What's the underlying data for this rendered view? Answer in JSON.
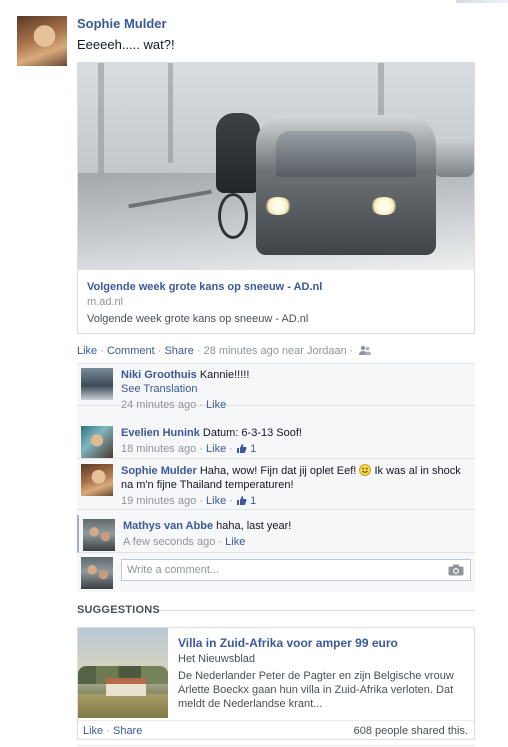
{
  "post": {
    "author": "Sophie Mulder",
    "message": "Eeeeeh..... wat?!",
    "share": {
      "title": "Volgende week grote kans op sneeuw - AD.nl",
      "domain": "m.ad.nl",
      "description": "Volgende week grote kans op sneeuw - AD.nl"
    },
    "actions": {
      "like": "Like",
      "comment": "Comment",
      "share": "Share",
      "separator": "·",
      "time": "28 minutes ago",
      "location": "near Jordaan",
      "audience_icon": "friends-icon"
    }
  },
  "comments": [
    {
      "name": "Niki Groothuis",
      "text": "Kannie!!!!!",
      "translate": "See Translation",
      "time": "24 minutes ago",
      "like": "Like",
      "likes": ""
    },
    {
      "name": "Evelien Hunink",
      "text": "Datum: 6-3-13 Soof!",
      "time": "18 minutes ago",
      "like": "Like",
      "likes": "1"
    },
    {
      "name": "Sophie Mulder",
      "text_part1": "Haha, wow! Fijn dat jij oplet Eef!",
      "text_part2": "Ik was al in shock na m'n fijne Thailand temperaturen!",
      "time": "19 minutes ago",
      "like": "Like",
      "likes": "1"
    },
    {
      "name": "Mathys van Abbe",
      "text": "haha, last year!",
      "time": "A few seconds ago",
      "like": "Like"
    }
  ],
  "compose": {
    "placeholder": "Write a comment...",
    "camera_icon": "camera-icon"
  },
  "suggestions": {
    "header": "SUGGESTIONS",
    "card": {
      "title": "Villa in Zuid-Afrika voor amper 99 euro",
      "source": "Het Nieuwsblad",
      "description": "De Nederlander Peter de Pagter en zijn Belgische vrouw Arlette Boeckx gaan hun villa in Zuid-Afrika verloten. Dat meldt de Nederlandse krant...",
      "like": "Like",
      "share": "Share",
      "separator": "·",
      "shared_count": "608 people shared this."
    }
  },
  "colors": {
    "link": "#3b5998",
    "muted": "#90949c",
    "ufi_background": "#f6f7f9"
  }
}
